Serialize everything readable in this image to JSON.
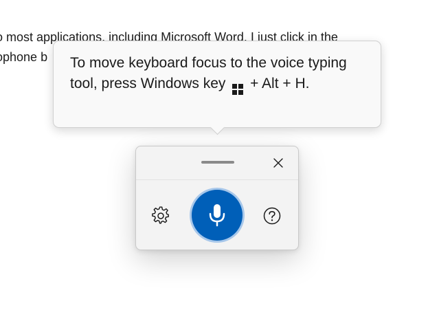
{
  "document": {
    "line1": "o most applications, including Microsoft Word. I just click in the",
    "line2": "ophone b"
  },
  "tooltip": {
    "text_before_icon": "To move keyboard focus to the voice typing tool, press Windows key",
    "text_after_icon": " + Alt + H."
  },
  "voice_typing": {
    "icons": {
      "drag": "drag-handle",
      "close": "close-icon",
      "settings": "gear-icon",
      "microphone": "microphone-icon",
      "help": "help-icon"
    },
    "colors": {
      "mic_button": "#005fb8",
      "mic_ring": "#a7c7ea",
      "panel_background": "#f3f3f3"
    }
  }
}
